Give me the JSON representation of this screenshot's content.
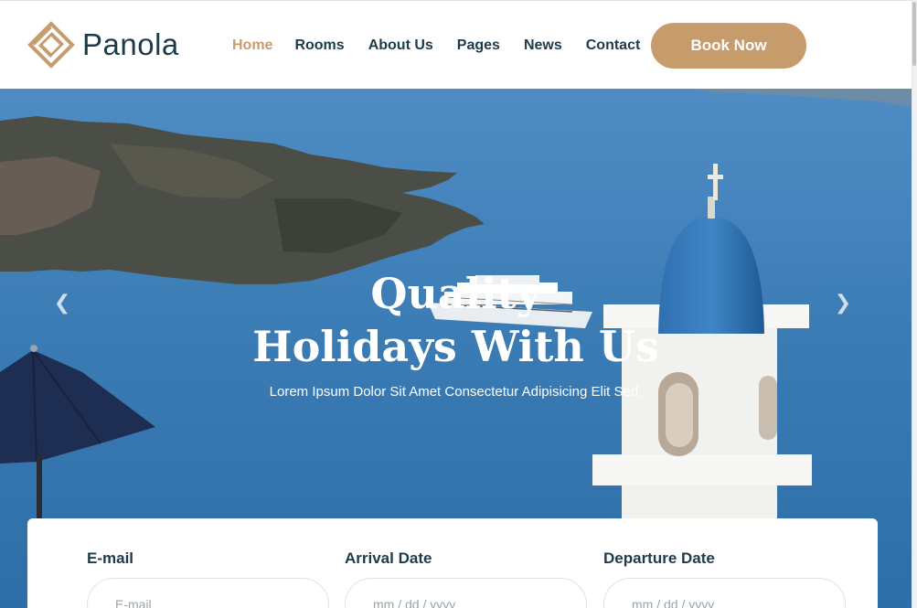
{
  "brand": {
    "name": "Panola",
    "accent": "#c69c6d",
    "dark": "#1d3b4b"
  },
  "nav": {
    "items": [
      {
        "label": "Home",
        "active": true
      },
      {
        "label": "Rooms",
        "active": false
      },
      {
        "label": "About Us",
        "active": false
      },
      {
        "label": "Pages",
        "active": false
      },
      {
        "label": "News",
        "active": false
      },
      {
        "label": "Contact",
        "active": false
      }
    ],
    "cta": "Book Now"
  },
  "hero": {
    "title_line1": "Quality",
    "title_line2": "Holidays With Us",
    "subtitle": "Lorem Ipsum Dolor Sit Amet Consectetur Adipisicing Elit Sed.",
    "prev_icon": "chevron-left-icon",
    "next_icon": "chevron-right-icon"
  },
  "booking": {
    "fields": [
      {
        "label": "E-mail",
        "placeholder": "E-mail"
      },
      {
        "label": "Arrival Date",
        "placeholder": "mm / dd / yyyy"
      },
      {
        "label": "Departure Date",
        "placeholder": "mm / dd / yyyy"
      }
    ]
  }
}
